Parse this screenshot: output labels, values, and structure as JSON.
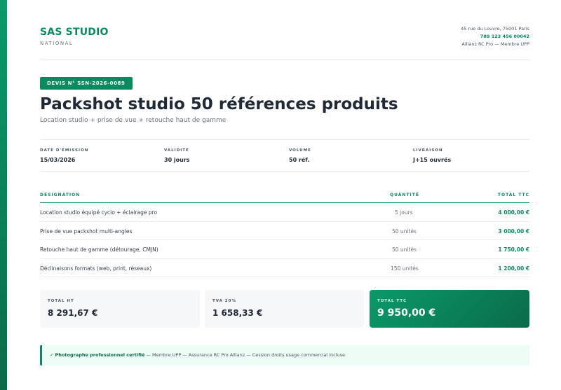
{
  "company": {
    "name": "SAS STUDIO",
    "subtitle": "NATIONAL",
    "address": "45 rue du Louvre, 75001 Paris",
    "phone": "789 123 456 00042",
    "insurance": "Allianz RC Pro — Membre UPP"
  },
  "quote": {
    "badge": "DEVIS N° SSN-2026-0089",
    "title": "Packshot studio 50 références produits",
    "subtitle": "Location studio + prise de vue + retouche haut de gamme"
  },
  "meta": [
    {
      "label": "DATE D'ÉMISSION",
      "value": "15/03/2026"
    },
    {
      "label": "VALIDITÉ",
      "value": "30 jours"
    },
    {
      "label": "VOLUME",
      "value": "50 réf."
    },
    {
      "label": "LIVRAISON",
      "value": "J+15 ouvrés"
    }
  ],
  "table": {
    "headers": {
      "designation": "DÉSIGNATION",
      "quantity": "QUANTITÉ",
      "total": "TOTAL TTC"
    },
    "rows": [
      {
        "designation": "Location studio équipé cyclo + éclairage pro",
        "quantity": "5 jours",
        "total": "4 000,00 €"
      },
      {
        "designation": "Prise de vue packshot multi-angles",
        "quantity": "50 unités",
        "total": "3 000,00 €"
      },
      {
        "designation": "Retouche haut de gamme (détourage, CMJN)",
        "quantity": "50 unités",
        "total": "1 750,00 €"
      },
      {
        "designation": "Déclinaisons formats (web, print, réseaux)",
        "quantity": "150 unités",
        "total": "1 200,00 €"
      }
    ]
  },
  "totals": {
    "ht_label": "TOTAL HT",
    "ht_value": "8 291,67 €",
    "tva_label": "TVA 20%",
    "tva_value": "1 658,33 €",
    "ttc_label": "TOTAL TTC",
    "ttc_value": "9 950,00 €"
  },
  "note": {
    "check": "✓",
    "strong": "Photographe professionnel certifié",
    "text": " — Membre UPP — Assurance RC Pro Allianz — Cession droits usage commercial incluse"
  },
  "colors": {
    "accent": "#0a8a5e",
    "accent_dark": "#0a6b49",
    "note_bg": "#ecfdf5"
  }
}
